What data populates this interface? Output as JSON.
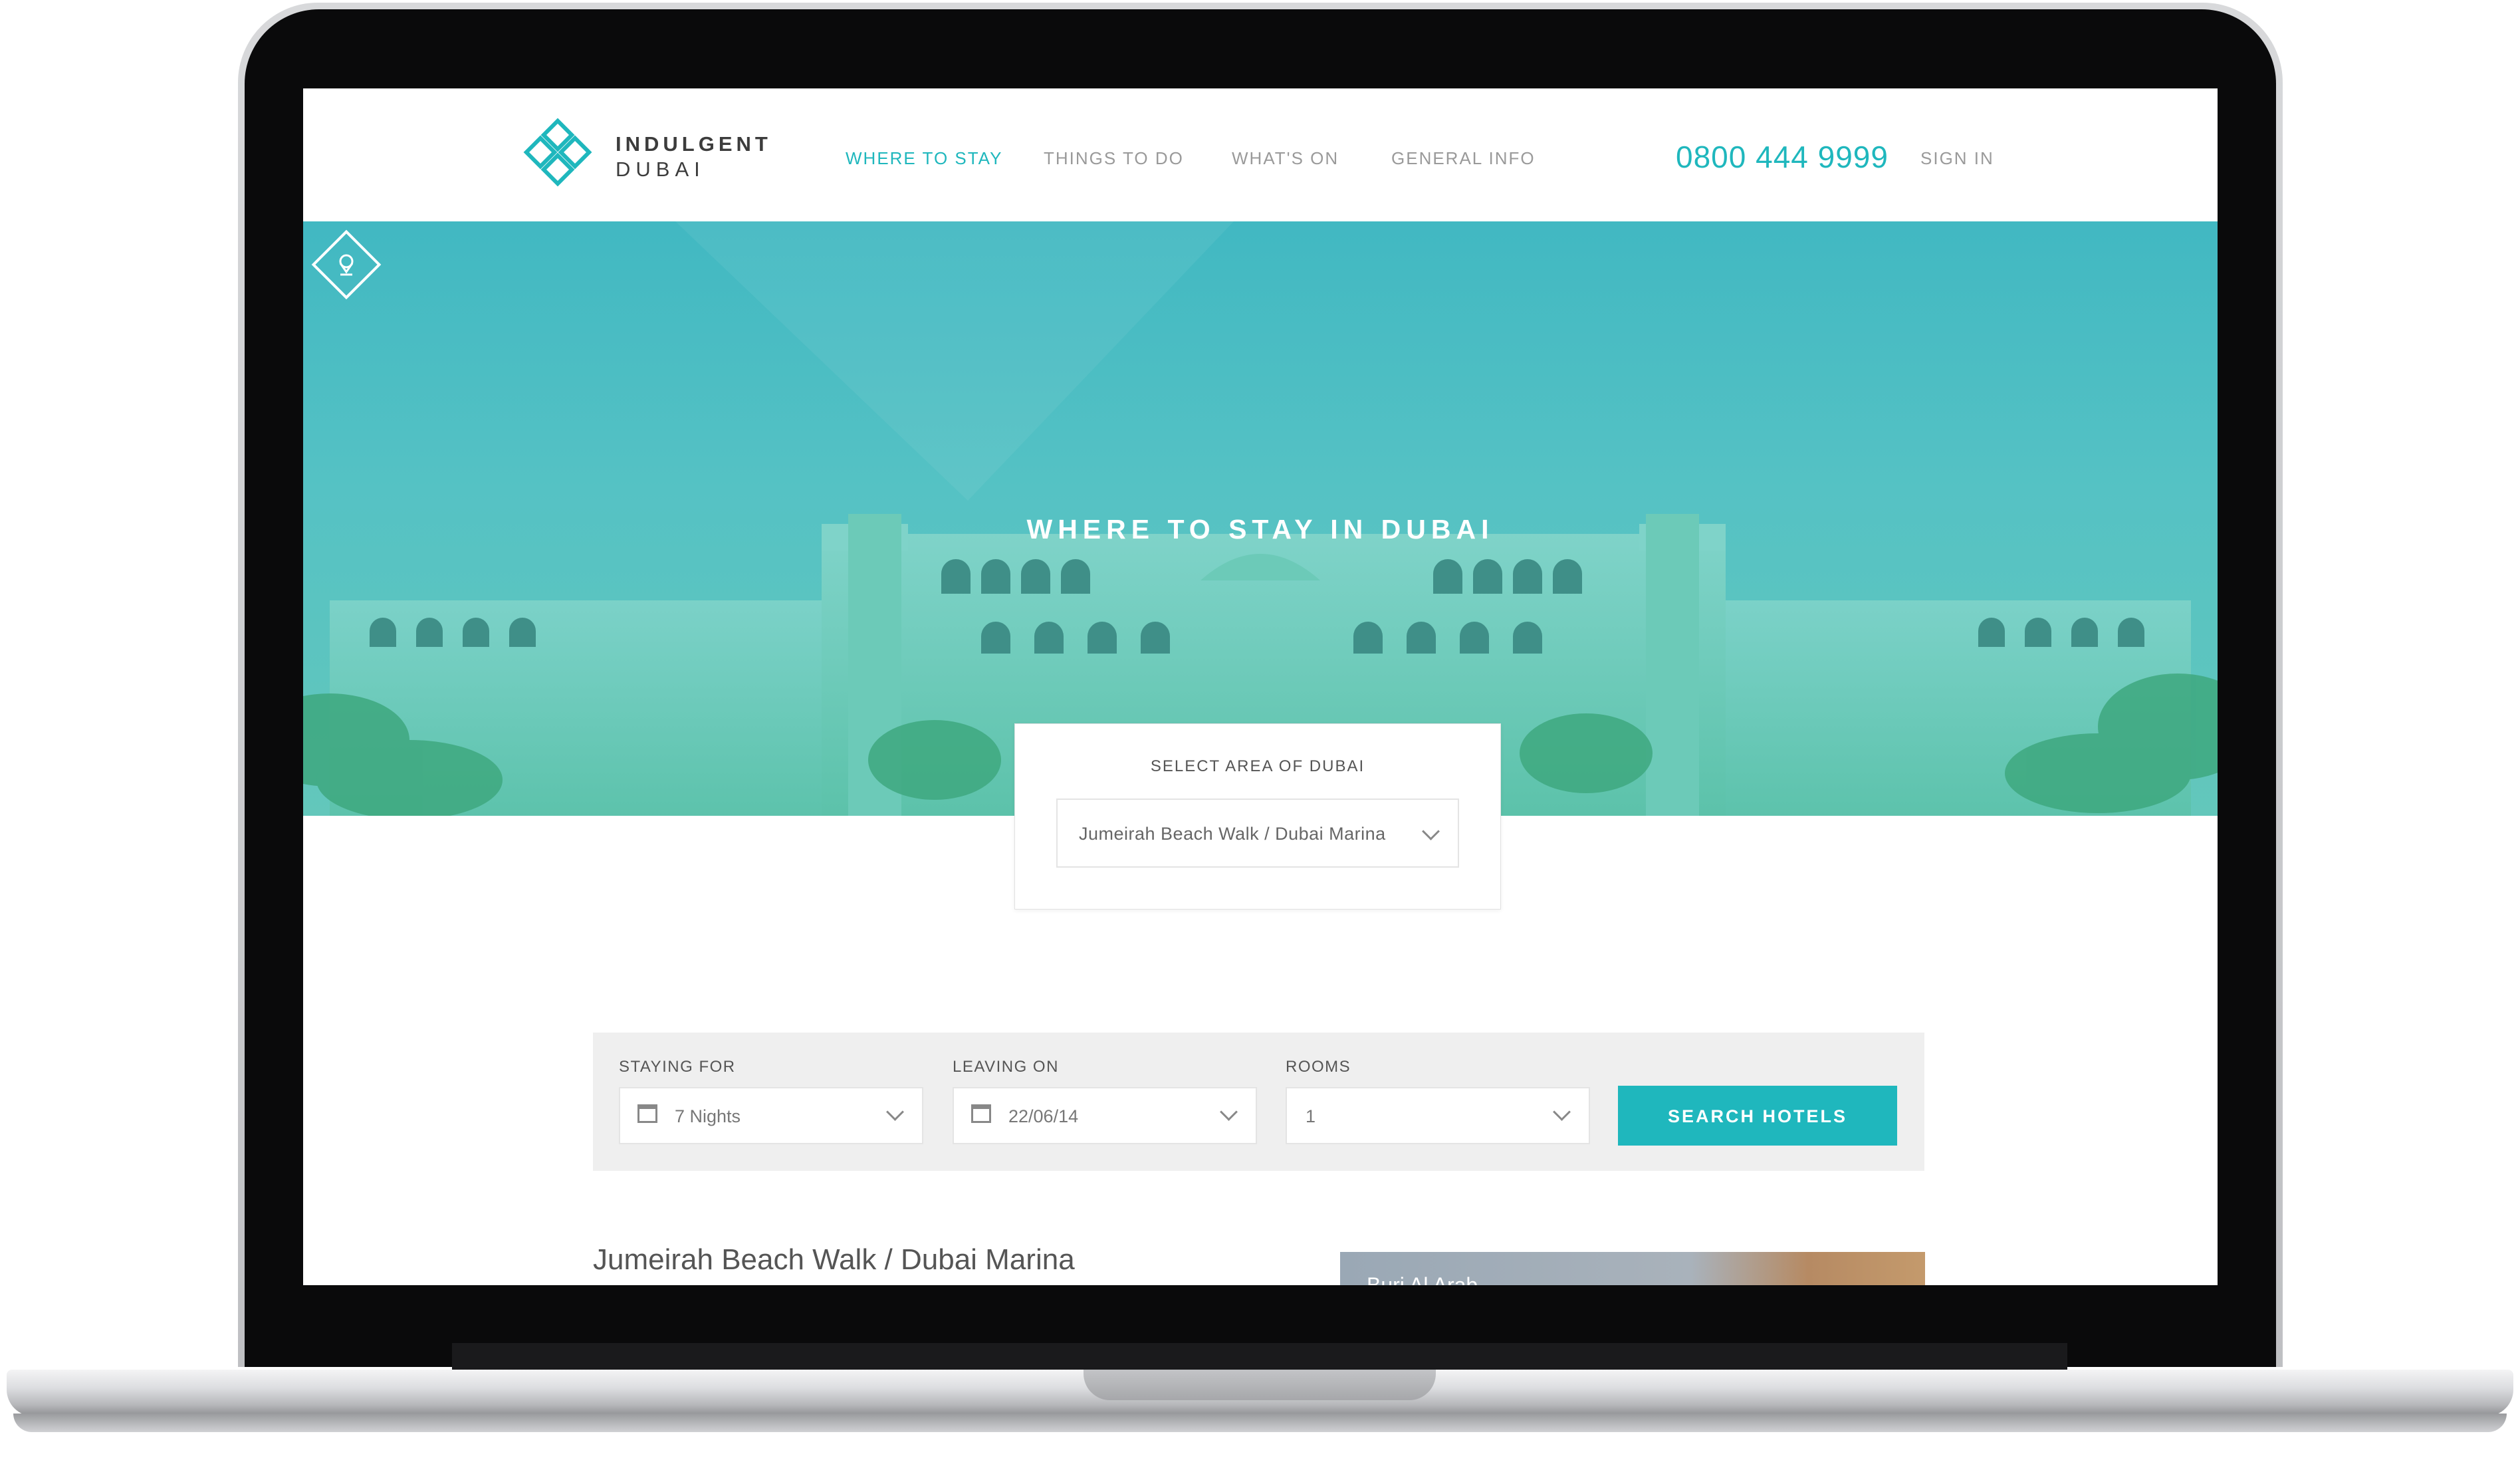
{
  "brand": {
    "line1": "INDULGENT",
    "line2": "DUBAI"
  },
  "nav": {
    "items": [
      {
        "label": "WHERE TO STAY",
        "active": true
      },
      {
        "label": "THINGS TO DO",
        "active": false
      },
      {
        "label": "WHAT'S ON",
        "active": false
      },
      {
        "label": "GENERAL INFO",
        "active": false
      }
    ],
    "phone": "0800 444 9999",
    "sign_in": "SIGN IN"
  },
  "hero": {
    "title": "WHERE TO STAY IN DUBAI",
    "icon": "map-pin-icon"
  },
  "area": {
    "label": "SELECT AREA OF DUBAI",
    "value": "Jumeirah Beach Walk / Dubai Marina"
  },
  "search": {
    "staying_label": "STAYING FOR",
    "staying_value": "7 Nights",
    "leaving_label": "LEAVING ON",
    "leaving_value": "22/06/14",
    "rooms_label": "ROOMS",
    "rooms_value": "1",
    "button": "SEARCH HOTELS"
  },
  "results": {
    "title": "Jumeirah Beach Walk / Dubai Marina",
    "thumb_caption": "Burj Al Arab"
  },
  "colors": {
    "accent": "#1fb7bd",
    "hero": "#4fbfc4",
    "search_bg": "#efefef"
  }
}
